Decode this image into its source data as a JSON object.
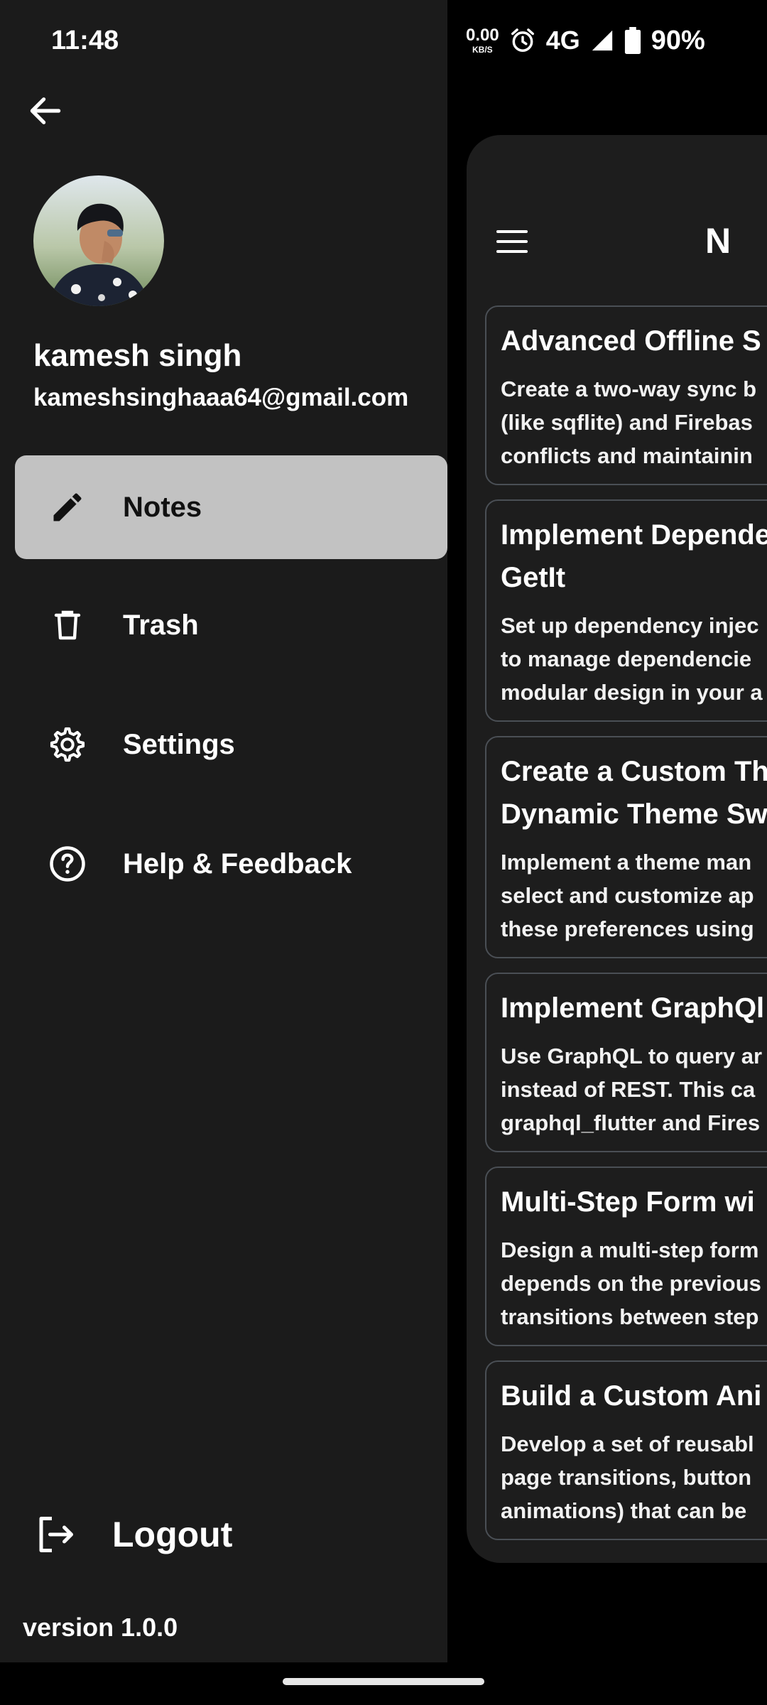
{
  "status_bar": {
    "time": "11:48",
    "net_speed_value": "0.00",
    "net_speed_unit": "KB/S",
    "network": "4G",
    "battery": "90%"
  },
  "drawer": {
    "user_name": "kamesh singh",
    "user_email": "kameshsinghaaa64@gmail.com",
    "items": [
      {
        "label": "Notes",
        "icon": "pencil-icon",
        "active": true
      },
      {
        "label": "Trash",
        "icon": "trash-icon",
        "active": false
      },
      {
        "label": "Settings",
        "icon": "gear-icon",
        "active": false
      },
      {
        "label": "Help & Feedback",
        "icon": "help-circle-icon",
        "active": false
      }
    ],
    "logout_label": "Logout",
    "version": "version 1.0.0"
  },
  "main": {
    "title": "N O",
    "notes": [
      {
        "title": "Advanced Offline S",
        "body": "Create a two-way sync b\n(like sqflite) and Firebas\nconflicts and maintainin"
      },
      {
        "title": "Implement Depende\nGetIt",
        "body": "Set up dependency injec\nto manage dependencie\nmodular design in your a"
      },
      {
        "title": "Create a Custom Th\nDynamic Theme Sw",
        "body": "Implement a theme man\nselect and customize ap\nthese preferences using"
      },
      {
        "title": "Implement GraphQl",
        "body": "Use GraphQL to query ar\ninstead of REST. This ca\ngraphql_flutter and Fires"
      },
      {
        "title": "Multi-Step Form wi",
        "body": "Design a multi-step form\ndepends on the previous\ntransitions between step"
      },
      {
        "title": "Build a Custom Ani",
        "body": "Develop a set of reusabl\npage transitions, button\nanimations) that can be"
      }
    ]
  },
  "colors": {
    "drawer_bg": "#1b1b1b",
    "active_item_bg": "#c2c2c2",
    "sheet_bg": "#1d1d1d",
    "card_border": "#4a4f55"
  }
}
